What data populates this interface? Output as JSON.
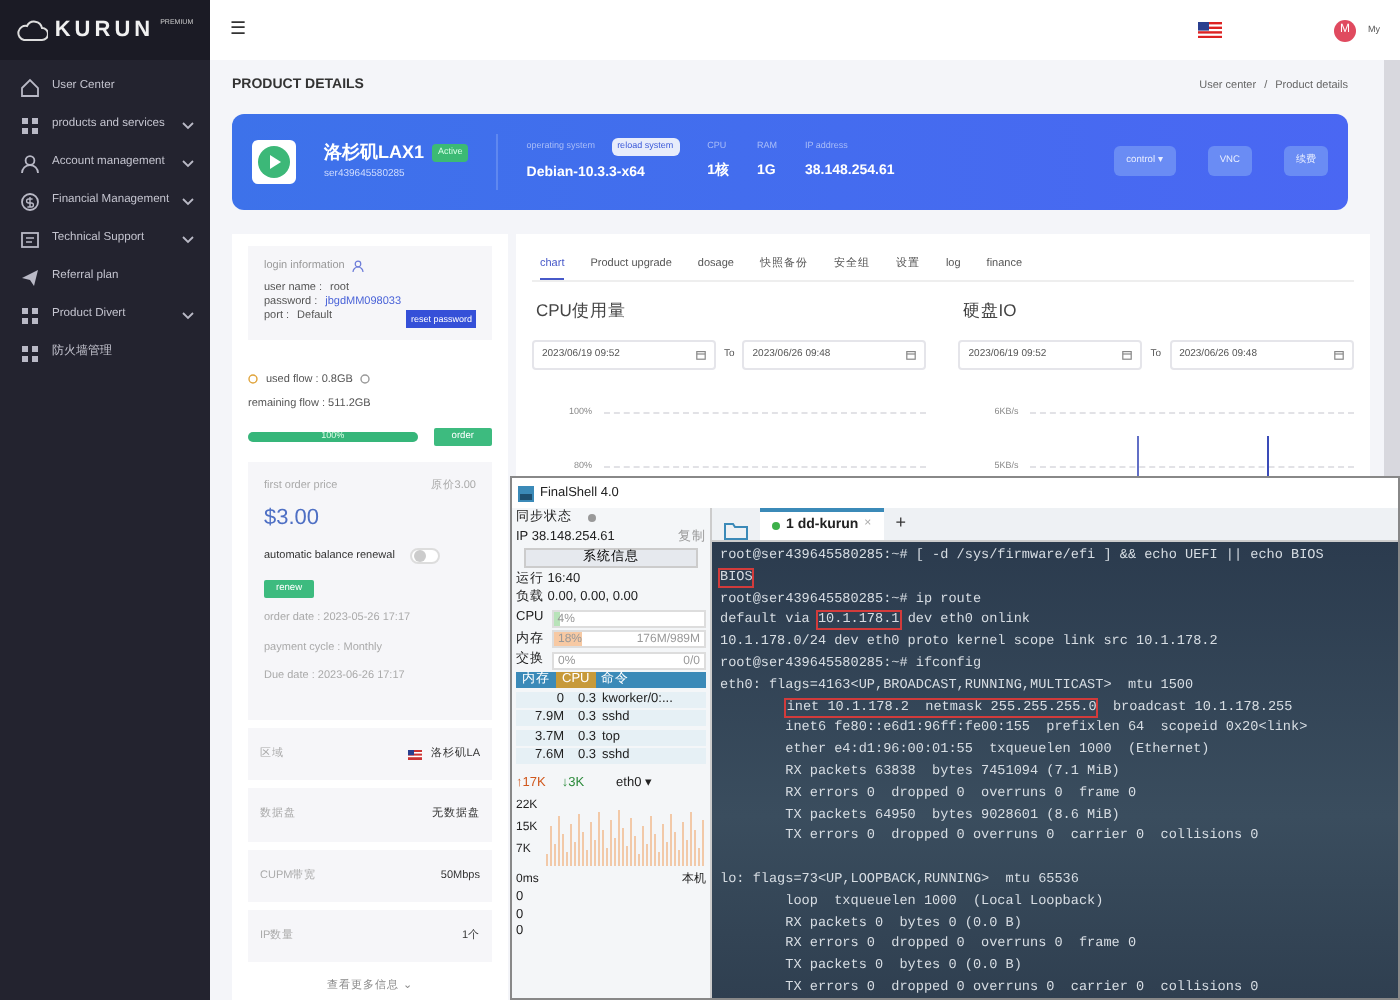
{
  "sidebar": {
    "logo": "KURUN",
    "logo_tag": "PREMIUM",
    "items": [
      {
        "label": "User Center",
        "expandable": false
      },
      {
        "label": "products and services",
        "expandable": true
      },
      {
        "label": "Account management",
        "expandable": true
      },
      {
        "label": "Financial Management",
        "expandable": true
      },
      {
        "label": "Technical Support",
        "expandable": true
      },
      {
        "label": "Referral plan",
        "expandable": false
      },
      {
        "label": "Product Divert",
        "expandable": true
      },
      {
        "label": "防火墙管理",
        "expandable": false
      }
    ]
  },
  "header": {
    "menu_glyph": "☰",
    "avatar_letter": "M",
    "user_label": "My"
  },
  "page": {
    "title": "PRODUCT DETAILS",
    "breadcrumb": [
      "User center",
      "/",
      "Product details"
    ]
  },
  "product": {
    "name": "洛杉矶LAX1",
    "status": "Active",
    "id": "ser439645580285",
    "os_label": "operating system",
    "reload_button": "reload system",
    "os": "Debian-10.3.3-x64",
    "specs": [
      {
        "label": "CPU",
        "value": "1核"
      },
      {
        "label": "RAM",
        "value": "1G"
      },
      {
        "label": "IP address",
        "value": "38.148.254.61"
      }
    ],
    "buttons": [
      "control ▾",
      "VNC",
      "续费"
    ]
  },
  "login": {
    "title": "login information",
    "lines": [
      {
        "label": "user name :",
        "value": "root",
        "kind": "plain"
      },
      {
        "label": "password :",
        "value": "jbgdMM098033",
        "kind": "link"
      },
      {
        "label": "port :",
        "value": "Default",
        "kind": "plain"
      }
    ],
    "reset_button": "reset password"
  },
  "flow": {
    "used": "used flow : 0.8GB",
    "remaining": "remaining flow : 511.2GB",
    "level": 1.0,
    "percent": "100%",
    "order_button": "order"
  },
  "billing": {
    "price_label": "first order price",
    "price_note": "原价3.00",
    "price": "$3.00",
    "renewal_label": "automatic balance renewal",
    "renewal_on": false,
    "renew_button": "renew",
    "lines": [
      "order date : 2023-05-26 17:17",
      "payment cycle : Monthly",
      "Due date : 2023-06-26 17:17"
    ]
  },
  "info_rows": [
    {
      "label": "区域",
      "value": "洛杉矶LA",
      "flag": true
    },
    {
      "label": "数据盘",
      "value": "无数据盘"
    },
    {
      "label": "CUPM带宽",
      "value": "50Mbps"
    },
    {
      "label": "IP数量",
      "value": "1个"
    }
  ],
  "more_link": "查看更多信息 ⌄",
  "tabs": [
    {
      "label": "chart",
      "selected": true
    },
    {
      "label": "Product upgrade",
      "selected": false
    },
    {
      "label": "dosage",
      "selected": false
    },
    {
      "label": "快照备份",
      "selected": false
    },
    {
      "label": "安全组",
      "selected": false
    },
    {
      "label": "设置",
      "selected": false
    },
    {
      "label": "log",
      "selected": false
    },
    {
      "label": "finance",
      "selected": false
    }
  ],
  "charts": [
    {
      "title": "CPU使用量",
      "from": "2023/06/19 09:52",
      "to_label": "To",
      "to": "2023/06/26 09:48",
      "y_labels": [
        "100%",
        "80%"
      ]
    },
    {
      "title": "硬盘IO",
      "from": "2023/06/19 09:52",
      "to_label": "To",
      "to": "2023/06/26 09:48",
      "y_labels": [
        "6KB/s",
        "5KB/s"
      ]
    }
  ],
  "finalshell": {
    "title": "FinalShell 4.0",
    "sync_label": "同步状态",
    "ip": "IP  38.148.254.61",
    "copy": "复制",
    "sysinfo_button": "系统信息",
    "uptime": "运行 16:40",
    "load": "负载 0.00, 0.00, 0.00",
    "meters": [
      {
        "label": "CPU",
        "percent": "4%",
        "level": 0.04
      },
      {
        "label": "内存",
        "percent": "18%",
        "level": 0.18,
        "detail": "176M/989M"
      },
      {
        "label": "交换",
        "percent": "0%",
        "level": 0.0,
        "detail": "0/0"
      }
    ],
    "process_columns": [
      {
        "label": "内存",
        "selected": false
      },
      {
        "label": "CPU",
        "selected": true
      },
      {
        "label": "命令",
        "selected": false
      }
    ],
    "processes": [
      [
        "0",
        "0.3",
        "kworker/0:..."
      ],
      [
        "7.9M",
        "0.3",
        "sshd"
      ],
      [
        "3.7M",
        "0.3",
        "top"
      ],
      [
        "7.6M",
        "0.3",
        "sshd"
      ]
    ],
    "net": {
      "up": "↑17K",
      "down": "↓3K",
      "iface": "eth0 ▾",
      "y_labels": [
        "22K",
        "15K",
        "7K"
      ]
    },
    "ping": {
      "header": "0ms",
      "host": "本机",
      "values": [
        "0",
        "0",
        "0"
      ]
    },
    "session_tab": "1 dd-kurun",
    "tab_close": "×",
    "tab_add": "+"
  },
  "terminal": {
    "lines": [
      {
        "segments": [
          {
            "text": "root@ser439645580285:~# [ -d /sys/firmware/efi ] && echo UEFI || echo BIOS",
            "boxed": false
          }
        ]
      },
      {
        "segments": [
          {
            "text": "BIOS",
            "boxed": true
          }
        ]
      },
      {
        "segments": [
          {
            "text": "root@ser439645580285:~# ip route",
            "boxed": false
          }
        ]
      },
      {
        "segments": [
          {
            "text": "default via ",
            "boxed": false
          },
          {
            "text": "10.1.178.1",
            "boxed": true
          },
          {
            "text": " dev eth0 onlink",
            "boxed": false
          }
        ]
      },
      {
        "segments": [
          {
            "text": "10.1.178.0/24 dev eth0 proto kernel scope link src 10.1.178.2",
            "boxed": false
          }
        ]
      },
      {
        "segments": [
          {
            "text": "root@ser439645580285:~# ifconfig",
            "boxed": false
          }
        ]
      },
      {
        "segments": [
          {
            "text": "eth0: flags=4163<UP,BROADCAST,RUNNING,MULTICAST>  mtu 1500",
            "boxed": false
          }
        ]
      },
      {
        "indented": true,
        "segments": [
          {
            "text": "inet 10.1.178.2  netmask 255.255.255.0",
            "boxed": true
          },
          {
            "text": "  broadcast 10.1.178.255",
            "boxed": false
          }
        ]
      },
      {
        "segments": [
          {
            "text": "        inet6 fe80::e6d1:96ff:fe00:155  prefixlen 64  scopeid 0x20<link>",
            "boxed": false
          }
        ]
      },
      {
        "segments": [
          {
            "text": "        ether e4:d1:96:00:01:55  txqueuelen 1000  (Ethernet)",
            "boxed": false
          }
        ]
      },
      {
        "segments": [
          {
            "text": "        RX packets 63838  bytes 7451094 (7.1 MiB)",
            "boxed": false
          }
        ]
      },
      {
        "segments": [
          {
            "text": "        RX errors 0  dropped 0  overruns 0  frame 0",
            "boxed": false
          }
        ]
      },
      {
        "segments": [
          {
            "text": "        TX packets 64950  bytes 9028601 (8.6 MiB)",
            "boxed": false
          }
        ]
      },
      {
        "segments": [
          {
            "text": "        TX errors 0  dropped 0 overruns 0  carrier 0  collisions 0",
            "boxed": false
          }
        ]
      },
      {
        "blank_before": true,
        "segments": [
          {
            "text": "lo: flags=73<UP,LOOPBACK,RUNNING>  mtu 65536",
            "boxed": false
          }
        ]
      },
      {
        "segments": [
          {
            "text": "        loop  txqueuelen 1000  (Local Loopback)",
            "boxed": false
          }
        ]
      },
      {
        "segments": [
          {
            "text": "        RX packets 0  bytes 0 (0.0 B)",
            "boxed": false
          }
        ]
      },
      {
        "segments": [
          {
            "text": "        RX errors 0  dropped 0  overruns 0  frame 0",
            "boxed": false
          }
        ]
      },
      {
        "segments": [
          {
            "text": "        TX packets 0  bytes 0 (0.0 B)",
            "boxed": false
          }
        ]
      },
      {
        "segments": [
          {
            "text": "        TX errors 0  dropped 0 overruns 0  carrier 0  collisions 0",
            "boxed": false
          }
        ]
      }
    ]
  }
}
